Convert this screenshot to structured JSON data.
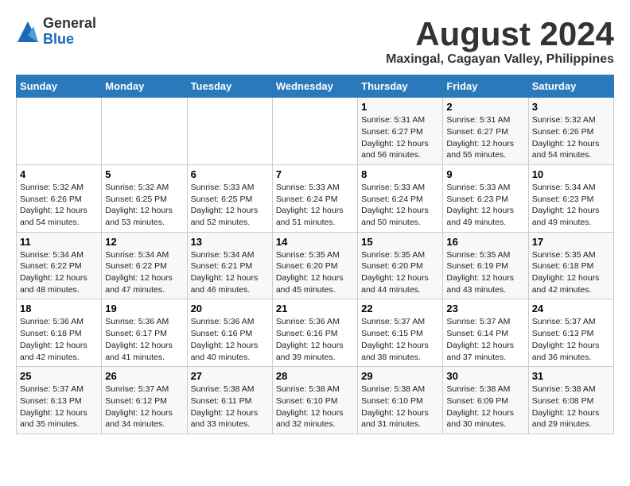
{
  "logo": {
    "general": "General",
    "blue": "Blue"
  },
  "title": "August 2024",
  "subtitle": "Maxingal, Cagayan Valley, Philippines",
  "days_of_week": [
    "Sunday",
    "Monday",
    "Tuesday",
    "Wednesday",
    "Thursday",
    "Friday",
    "Saturday"
  ],
  "weeks": [
    [
      {
        "day": "",
        "info": ""
      },
      {
        "day": "",
        "info": ""
      },
      {
        "day": "",
        "info": ""
      },
      {
        "day": "",
        "info": ""
      },
      {
        "day": "1",
        "info": "Sunrise: 5:31 AM\nSunset: 6:27 PM\nDaylight: 12 hours\nand 56 minutes."
      },
      {
        "day": "2",
        "info": "Sunrise: 5:31 AM\nSunset: 6:27 PM\nDaylight: 12 hours\nand 55 minutes."
      },
      {
        "day": "3",
        "info": "Sunrise: 5:32 AM\nSunset: 6:26 PM\nDaylight: 12 hours\nand 54 minutes."
      }
    ],
    [
      {
        "day": "4",
        "info": "Sunrise: 5:32 AM\nSunset: 6:26 PM\nDaylight: 12 hours\nand 54 minutes."
      },
      {
        "day": "5",
        "info": "Sunrise: 5:32 AM\nSunset: 6:25 PM\nDaylight: 12 hours\nand 53 minutes."
      },
      {
        "day": "6",
        "info": "Sunrise: 5:33 AM\nSunset: 6:25 PM\nDaylight: 12 hours\nand 52 minutes."
      },
      {
        "day": "7",
        "info": "Sunrise: 5:33 AM\nSunset: 6:24 PM\nDaylight: 12 hours\nand 51 minutes."
      },
      {
        "day": "8",
        "info": "Sunrise: 5:33 AM\nSunset: 6:24 PM\nDaylight: 12 hours\nand 50 minutes."
      },
      {
        "day": "9",
        "info": "Sunrise: 5:33 AM\nSunset: 6:23 PM\nDaylight: 12 hours\nand 49 minutes."
      },
      {
        "day": "10",
        "info": "Sunrise: 5:34 AM\nSunset: 6:23 PM\nDaylight: 12 hours\nand 49 minutes."
      }
    ],
    [
      {
        "day": "11",
        "info": "Sunrise: 5:34 AM\nSunset: 6:22 PM\nDaylight: 12 hours\nand 48 minutes."
      },
      {
        "day": "12",
        "info": "Sunrise: 5:34 AM\nSunset: 6:22 PM\nDaylight: 12 hours\nand 47 minutes."
      },
      {
        "day": "13",
        "info": "Sunrise: 5:34 AM\nSunset: 6:21 PM\nDaylight: 12 hours\nand 46 minutes."
      },
      {
        "day": "14",
        "info": "Sunrise: 5:35 AM\nSunset: 6:20 PM\nDaylight: 12 hours\nand 45 minutes."
      },
      {
        "day": "15",
        "info": "Sunrise: 5:35 AM\nSunset: 6:20 PM\nDaylight: 12 hours\nand 44 minutes."
      },
      {
        "day": "16",
        "info": "Sunrise: 5:35 AM\nSunset: 6:19 PM\nDaylight: 12 hours\nand 43 minutes."
      },
      {
        "day": "17",
        "info": "Sunrise: 5:35 AM\nSunset: 6:18 PM\nDaylight: 12 hours\nand 42 minutes."
      }
    ],
    [
      {
        "day": "18",
        "info": "Sunrise: 5:36 AM\nSunset: 6:18 PM\nDaylight: 12 hours\nand 42 minutes."
      },
      {
        "day": "19",
        "info": "Sunrise: 5:36 AM\nSunset: 6:17 PM\nDaylight: 12 hours\nand 41 minutes."
      },
      {
        "day": "20",
        "info": "Sunrise: 5:36 AM\nSunset: 6:16 PM\nDaylight: 12 hours\nand 40 minutes."
      },
      {
        "day": "21",
        "info": "Sunrise: 5:36 AM\nSunset: 6:16 PM\nDaylight: 12 hours\nand 39 minutes."
      },
      {
        "day": "22",
        "info": "Sunrise: 5:37 AM\nSunset: 6:15 PM\nDaylight: 12 hours\nand 38 minutes."
      },
      {
        "day": "23",
        "info": "Sunrise: 5:37 AM\nSunset: 6:14 PM\nDaylight: 12 hours\nand 37 minutes."
      },
      {
        "day": "24",
        "info": "Sunrise: 5:37 AM\nSunset: 6:13 PM\nDaylight: 12 hours\nand 36 minutes."
      }
    ],
    [
      {
        "day": "25",
        "info": "Sunrise: 5:37 AM\nSunset: 6:13 PM\nDaylight: 12 hours\nand 35 minutes."
      },
      {
        "day": "26",
        "info": "Sunrise: 5:37 AM\nSunset: 6:12 PM\nDaylight: 12 hours\nand 34 minutes."
      },
      {
        "day": "27",
        "info": "Sunrise: 5:38 AM\nSunset: 6:11 PM\nDaylight: 12 hours\nand 33 minutes."
      },
      {
        "day": "28",
        "info": "Sunrise: 5:38 AM\nSunset: 6:10 PM\nDaylight: 12 hours\nand 32 minutes."
      },
      {
        "day": "29",
        "info": "Sunrise: 5:38 AM\nSunset: 6:10 PM\nDaylight: 12 hours\nand 31 minutes."
      },
      {
        "day": "30",
        "info": "Sunrise: 5:38 AM\nSunset: 6:09 PM\nDaylight: 12 hours\nand 30 minutes."
      },
      {
        "day": "31",
        "info": "Sunrise: 5:38 AM\nSunset: 6:08 PM\nDaylight: 12 hours\nand 29 minutes."
      }
    ]
  ]
}
